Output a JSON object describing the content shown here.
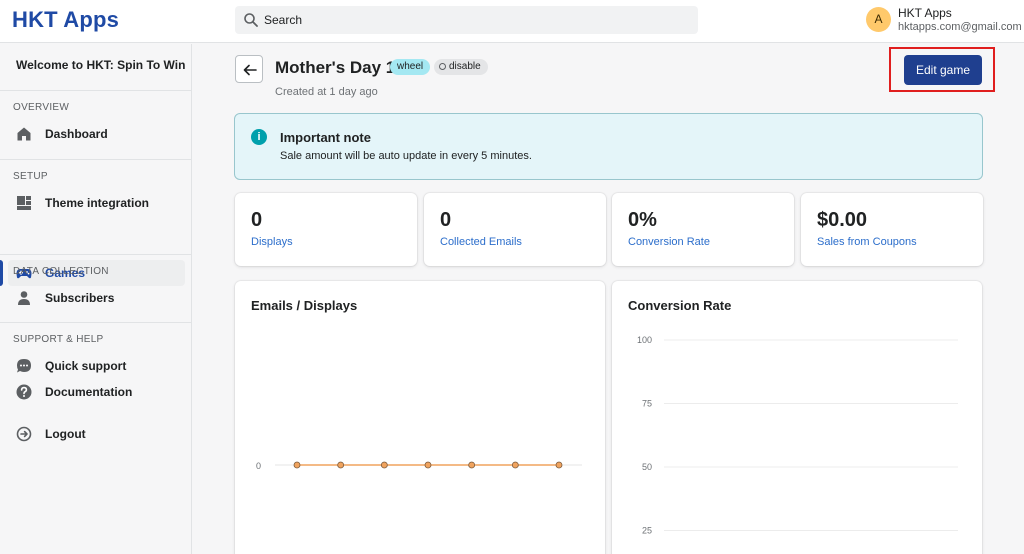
{
  "app": {
    "logo": "HKT Apps"
  },
  "search": {
    "placeholder": "Search"
  },
  "user": {
    "initial": "A",
    "name": "HKT Apps",
    "email": "hktapps.com@gmail.com"
  },
  "sidebar": {
    "welcome": "Welcome to HKT: Spin To Win",
    "sections": [
      {
        "heading": "OVERVIEW",
        "items": [
          {
            "label": "Dashboard",
            "icon": "home-icon"
          }
        ]
      },
      {
        "heading": "SETUP",
        "items": [
          {
            "label": "Theme integration",
            "icon": "theme-icon"
          },
          {
            "label": "Games",
            "icon": "gamepad-icon",
            "active": true
          }
        ]
      },
      {
        "heading": "DATA COLLECTION",
        "items": [
          {
            "label": "Subscribers",
            "icon": "user-icon"
          }
        ]
      },
      {
        "heading": "SUPPORT & HELP",
        "items": [
          {
            "label": "Quick support",
            "icon": "chat-icon"
          },
          {
            "label": "Documentation",
            "icon": "help-icon"
          }
        ]
      }
    ],
    "logout": "Logout"
  },
  "game": {
    "title": "Mother's Day 1",
    "type_badge": "wheel",
    "status_badge": "disable",
    "created": "Created at 1 day ago",
    "edit_label": "Edit game"
  },
  "banner": {
    "title": "Important note",
    "text": "Sale amount will be auto update in every 5 minutes."
  },
  "stats": [
    {
      "value": "0",
      "label": "Displays"
    },
    {
      "value": "0",
      "label": "Collected Emails"
    },
    {
      "value": "0%",
      "label": "Conversion Rate"
    },
    {
      "value": "$0.00",
      "label": "Sales from Coupons"
    }
  ],
  "colors": {
    "brand": "#1f4aa5",
    "accent_line": "#f0a35e",
    "link": "#2c6ecb"
  },
  "chart_data": [
    {
      "type": "line",
      "title": "Emails / Displays",
      "y_ticks": [
        "0"
      ],
      "x_count": 7,
      "series": [
        {
          "values": [
            0,
            0,
            0,
            0,
            0,
            0,
            0
          ]
        }
      ],
      "color": "#f0a35e"
    },
    {
      "type": "line",
      "title": "Conversion Rate",
      "y_ticks": [
        "100",
        "75",
        "50",
        "25"
      ],
      "ylim": [
        0,
        100
      ],
      "grid": true,
      "series": []
    }
  ]
}
